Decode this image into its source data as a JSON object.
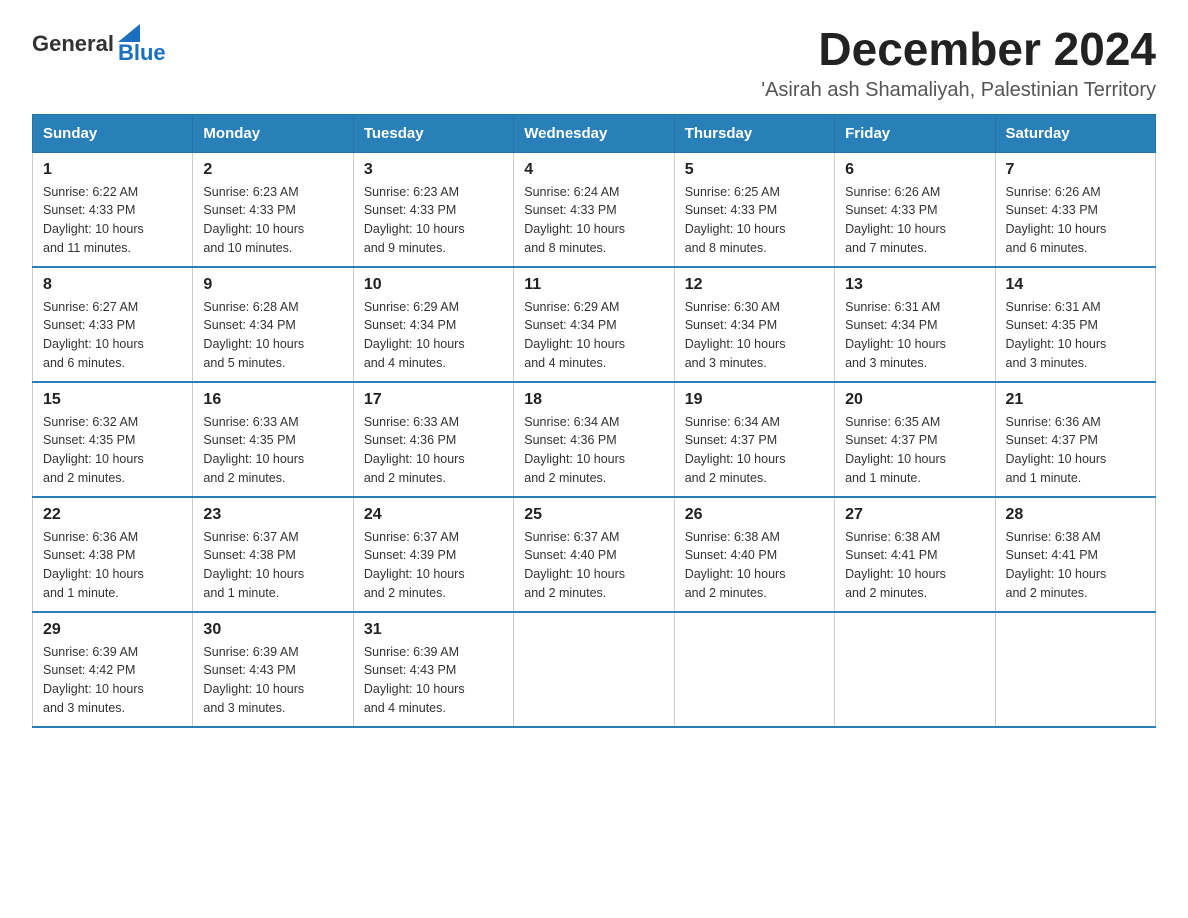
{
  "header": {
    "logo_general": "General",
    "logo_blue": "Blue",
    "month_year": "December 2024",
    "location": "'Asirah ash Shamaliyah, Palestinian Territory"
  },
  "columns": [
    "Sunday",
    "Monday",
    "Tuesday",
    "Wednesday",
    "Thursday",
    "Friday",
    "Saturday"
  ],
  "weeks": [
    [
      {
        "day": "1",
        "sunrise": "6:22 AM",
        "sunset": "4:33 PM",
        "daylight": "10 hours and 11 minutes."
      },
      {
        "day": "2",
        "sunrise": "6:23 AM",
        "sunset": "4:33 PM",
        "daylight": "10 hours and 10 minutes."
      },
      {
        "day": "3",
        "sunrise": "6:23 AM",
        "sunset": "4:33 PM",
        "daylight": "10 hours and 9 minutes."
      },
      {
        "day": "4",
        "sunrise": "6:24 AM",
        "sunset": "4:33 PM",
        "daylight": "10 hours and 8 minutes."
      },
      {
        "day": "5",
        "sunrise": "6:25 AM",
        "sunset": "4:33 PM",
        "daylight": "10 hours and 8 minutes."
      },
      {
        "day": "6",
        "sunrise": "6:26 AM",
        "sunset": "4:33 PM",
        "daylight": "10 hours and 7 minutes."
      },
      {
        "day": "7",
        "sunrise": "6:26 AM",
        "sunset": "4:33 PM",
        "daylight": "10 hours and 6 minutes."
      }
    ],
    [
      {
        "day": "8",
        "sunrise": "6:27 AM",
        "sunset": "4:33 PM",
        "daylight": "10 hours and 6 minutes."
      },
      {
        "day": "9",
        "sunrise": "6:28 AM",
        "sunset": "4:34 PM",
        "daylight": "10 hours and 5 minutes."
      },
      {
        "day": "10",
        "sunrise": "6:29 AM",
        "sunset": "4:34 PM",
        "daylight": "10 hours and 4 minutes."
      },
      {
        "day": "11",
        "sunrise": "6:29 AM",
        "sunset": "4:34 PM",
        "daylight": "10 hours and 4 minutes."
      },
      {
        "day": "12",
        "sunrise": "6:30 AM",
        "sunset": "4:34 PM",
        "daylight": "10 hours and 3 minutes."
      },
      {
        "day": "13",
        "sunrise": "6:31 AM",
        "sunset": "4:34 PM",
        "daylight": "10 hours and 3 minutes."
      },
      {
        "day": "14",
        "sunrise": "6:31 AM",
        "sunset": "4:35 PM",
        "daylight": "10 hours and 3 minutes."
      }
    ],
    [
      {
        "day": "15",
        "sunrise": "6:32 AM",
        "sunset": "4:35 PM",
        "daylight": "10 hours and 2 minutes."
      },
      {
        "day": "16",
        "sunrise": "6:33 AM",
        "sunset": "4:35 PM",
        "daylight": "10 hours and 2 minutes."
      },
      {
        "day": "17",
        "sunrise": "6:33 AM",
        "sunset": "4:36 PM",
        "daylight": "10 hours and 2 minutes."
      },
      {
        "day": "18",
        "sunrise": "6:34 AM",
        "sunset": "4:36 PM",
        "daylight": "10 hours and 2 minutes."
      },
      {
        "day": "19",
        "sunrise": "6:34 AM",
        "sunset": "4:37 PM",
        "daylight": "10 hours and 2 minutes."
      },
      {
        "day": "20",
        "sunrise": "6:35 AM",
        "sunset": "4:37 PM",
        "daylight": "10 hours and 1 minute."
      },
      {
        "day": "21",
        "sunrise": "6:36 AM",
        "sunset": "4:37 PM",
        "daylight": "10 hours and 1 minute."
      }
    ],
    [
      {
        "day": "22",
        "sunrise": "6:36 AM",
        "sunset": "4:38 PM",
        "daylight": "10 hours and 1 minute."
      },
      {
        "day": "23",
        "sunrise": "6:37 AM",
        "sunset": "4:38 PM",
        "daylight": "10 hours and 1 minute."
      },
      {
        "day": "24",
        "sunrise": "6:37 AM",
        "sunset": "4:39 PM",
        "daylight": "10 hours and 2 minutes."
      },
      {
        "day": "25",
        "sunrise": "6:37 AM",
        "sunset": "4:40 PM",
        "daylight": "10 hours and 2 minutes."
      },
      {
        "day": "26",
        "sunrise": "6:38 AM",
        "sunset": "4:40 PM",
        "daylight": "10 hours and 2 minutes."
      },
      {
        "day": "27",
        "sunrise": "6:38 AM",
        "sunset": "4:41 PM",
        "daylight": "10 hours and 2 minutes."
      },
      {
        "day": "28",
        "sunrise": "6:38 AM",
        "sunset": "4:41 PM",
        "daylight": "10 hours and 2 minutes."
      }
    ],
    [
      {
        "day": "29",
        "sunrise": "6:39 AM",
        "sunset": "4:42 PM",
        "daylight": "10 hours and 3 minutes."
      },
      {
        "day": "30",
        "sunrise": "6:39 AM",
        "sunset": "4:43 PM",
        "daylight": "10 hours and 3 minutes."
      },
      {
        "day": "31",
        "sunrise": "6:39 AM",
        "sunset": "4:43 PM",
        "daylight": "10 hours and 4 minutes."
      },
      null,
      null,
      null,
      null
    ]
  ],
  "labels": {
    "sunrise": "Sunrise:",
    "sunset": "Sunset:",
    "daylight": "Daylight:"
  }
}
